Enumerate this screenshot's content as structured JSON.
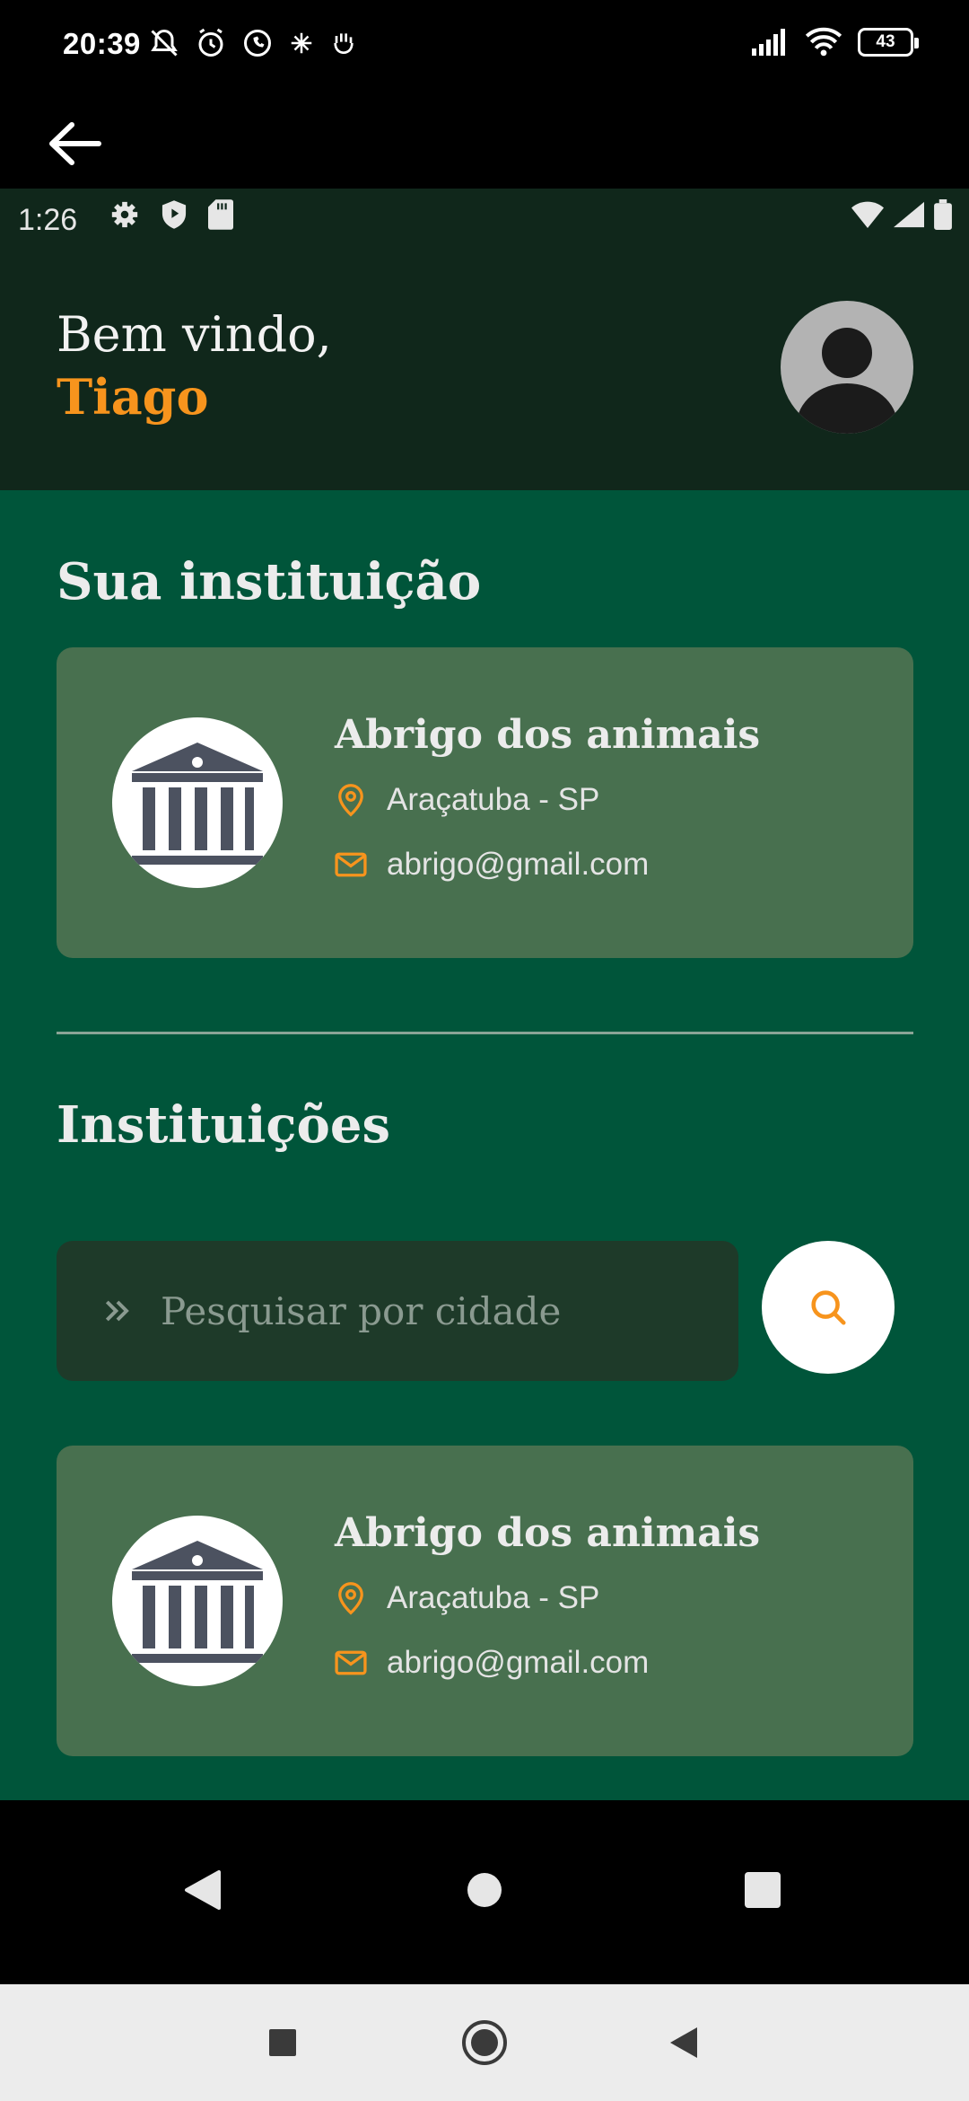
{
  "outer_status": {
    "time": "20:39",
    "battery": "43"
  },
  "inner_status": {
    "time": "1:26"
  },
  "header": {
    "greeting": "Bem vindo,",
    "user_name": "Tiago"
  },
  "my_institution": {
    "section_title": "Sua instituição",
    "card": {
      "name": "Abrigo dos animais",
      "location": "Araçatuba - SP",
      "email": "abrigo@gmail.com"
    }
  },
  "institutions": {
    "section_title": "Instituições",
    "search": {
      "placeholder": "Pesquisar por cidade",
      "value": ""
    },
    "items": [
      {
        "name": "Abrigo dos animais",
        "location": "Araçatuba - SP",
        "email": "abrigo@gmail.com"
      }
    ]
  },
  "colors": {
    "accent": "#f7941d",
    "background": "#00553a",
    "header_bg": "#10271b",
    "card_bg": "#48704f",
    "search_bg": "#1e3a29"
  },
  "icons": {
    "back": "back-arrow-icon",
    "avatar": "user-avatar-icon",
    "institution_logo": "institution-building-icon",
    "location": "location-pin-icon",
    "email": "mail-icon",
    "search_prefix": "double-chevron-right-icon",
    "search_button": "search-icon"
  }
}
